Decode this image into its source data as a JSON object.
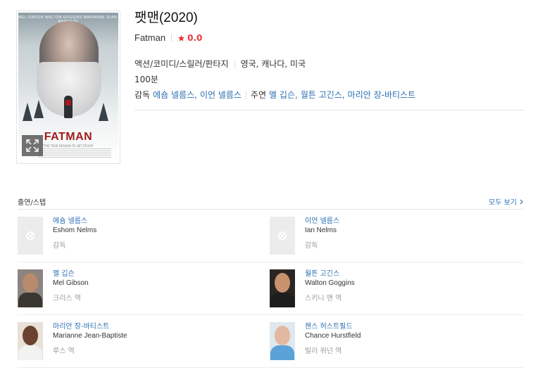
{
  "movie": {
    "title": "팻맨(2020)",
    "original_title": "Fatman",
    "rating": "0.0",
    "genres": "액션/코미디/스릴러/판타지",
    "countries": "영국, 캐나다, 미국",
    "runtime": "100분",
    "director_label": "감독",
    "directors": [
      "에숌 넬름스",
      "이언 넬름스"
    ],
    "cast_label": "주연",
    "stars": [
      "멜 깁슨",
      "월튼 고긴스",
      "마리안 장-바티스트"
    ]
  },
  "poster": {
    "cast_line": "MEL GIBSON   WALTON GOGGINS   MARIANNE JEAN-BAPTISTE",
    "title": "FATMAN",
    "tagline": "\"THE TRUE REASON TO GET STUCK\""
  },
  "cast_section": {
    "heading": "출연/스탭",
    "see_all": "모두 보기"
  },
  "cast": [
    {
      "name": "에숌 넬름스",
      "name_en": "Eshom Nelms",
      "role": "감독",
      "photo": "placeholder"
    },
    {
      "name": "이언 넬름스",
      "name_en": "Ian Nelms",
      "role": "감독",
      "photo": "placeholder"
    },
    {
      "name": "멜 깁슨",
      "name_en": "Mel Gibson",
      "role": "크리스 역",
      "photo": "real",
      "skin": "#b98a6c",
      "shirt": "#3a3632",
      "bg": "#8b8480"
    },
    {
      "name": "월튼 고긴스",
      "name_en": "Walton Goggins",
      "role": "스키니 맨 역",
      "photo": "real",
      "skin": "#c8926e",
      "shirt": "#1d1d1d",
      "bg": "#2a2522"
    },
    {
      "name": "마리안 장-바티스트",
      "name_en": "Marianne Jean-Baptiste",
      "role": "루스 역",
      "photo": "real",
      "skin": "#6b4230",
      "shirt": "#f2f2f2",
      "bg": "#e8e1d8"
    },
    {
      "name": "챈스 허스트필드",
      "name_en": "Chance Hurstfield",
      "role": "빌리 위넌 역",
      "photo": "real",
      "skin": "#e2b9a0",
      "shirt": "#5aa2d8",
      "bg": "#dfe8ee"
    }
  ],
  "colors": {
    "link": "#2b6db3",
    "rating": "#e63a3a"
  }
}
